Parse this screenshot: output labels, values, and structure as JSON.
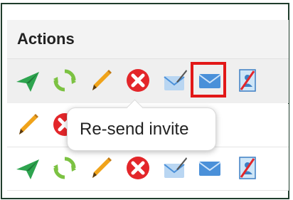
{
  "table": {
    "header": {
      "title": "Actions"
    },
    "rows": [
      {
        "actions": [
          "send-icon",
          "refresh-icon",
          "edit-pencil-icon",
          "delete-icon",
          "signed-envelope-icon",
          "mail-envelope-icon",
          "revoke-document-icon"
        ]
      },
      {
        "actions": [
          "edit-pencil-icon",
          "delete-icon"
        ]
      },
      {
        "actions": [
          "send-icon",
          "refresh-icon",
          "edit-pencil-icon",
          "delete-icon",
          "signed-envelope-icon",
          "mail-envelope-icon",
          "revoke-document-icon"
        ]
      }
    ]
  },
  "tooltip": {
    "text": "Re-send invite",
    "target": "mail-envelope-icon"
  },
  "colors": {
    "highlight": "#e21818",
    "send": "#2ea44f",
    "refresh": "#7cc242",
    "pencil": "#f0a31a",
    "delete": "#e3262a",
    "envelope": "#4a90d9"
  }
}
